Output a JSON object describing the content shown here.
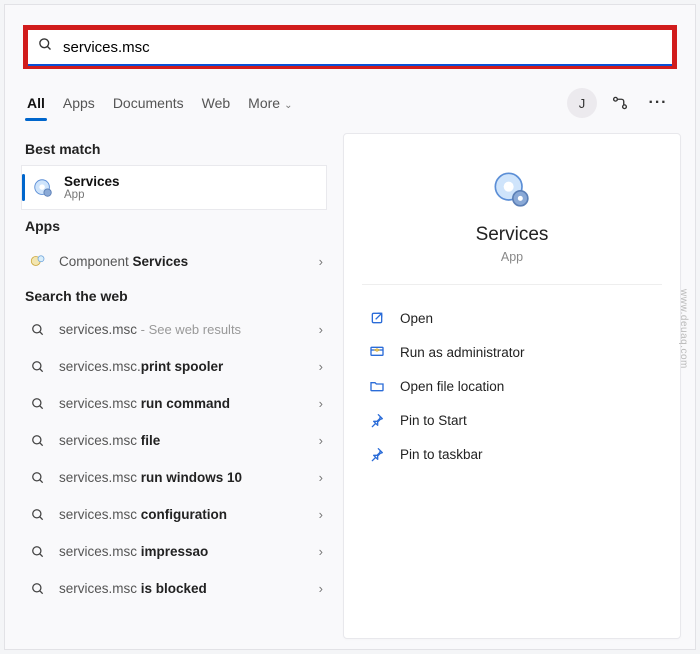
{
  "search": {
    "value": "services.msc",
    "placeholder": ""
  },
  "tabs": {
    "items": [
      "All",
      "Apps",
      "Documents",
      "Web",
      "More"
    ],
    "active_index": 0
  },
  "header": {
    "avatar_initial": "J"
  },
  "left": {
    "best_match_header": "Best match",
    "best_match": {
      "title": "Services",
      "subtitle": "App"
    },
    "apps_header": "Apps",
    "apps": [
      {
        "prefix": "Component ",
        "bold": "Services"
      }
    ],
    "web_header": "Search the web",
    "web": [
      {
        "prefix": "services.msc",
        "bold": "",
        "hint": " - See web results"
      },
      {
        "prefix": "services.msc.",
        "bold": "print spooler",
        "hint": ""
      },
      {
        "prefix": "services.msc ",
        "bold": "run command",
        "hint": ""
      },
      {
        "prefix": "services.msc ",
        "bold": "file",
        "hint": ""
      },
      {
        "prefix": "services.msc ",
        "bold": "run windows 10",
        "hint": ""
      },
      {
        "prefix": "services.msc ",
        "bold": "configuration",
        "hint": ""
      },
      {
        "prefix": "services.msc ",
        "bold": "impressao",
        "hint": ""
      },
      {
        "prefix": "services.msc ",
        "bold": "is blocked",
        "hint": ""
      }
    ]
  },
  "preview": {
    "title": "Services",
    "subtitle": "App",
    "actions": [
      {
        "icon": "open",
        "label": "Open"
      },
      {
        "icon": "admin",
        "label": "Run as administrator"
      },
      {
        "icon": "folder",
        "label": "Open file location"
      },
      {
        "icon": "pin",
        "label": "Pin to Start"
      },
      {
        "icon": "pin",
        "label": "Pin to taskbar"
      }
    ]
  },
  "watermark": "www.deuaq.com"
}
